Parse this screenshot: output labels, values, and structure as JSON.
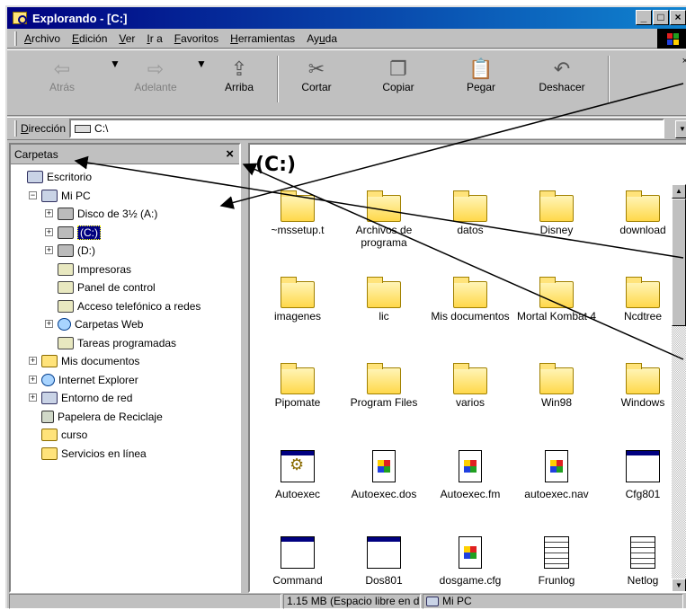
{
  "window": {
    "title": "Explorando - [C:]",
    "controls": [
      "_",
      "□",
      "×"
    ]
  },
  "menu": [
    {
      "key": "A",
      "rest": "rchivo"
    },
    {
      "key": "E",
      "rest": "dición"
    },
    {
      "key": "V",
      "rest": "er"
    },
    {
      "key": "I",
      "rest": "r a"
    },
    {
      "key": "F",
      "rest": "avoritos"
    },
    {
      "key": "H",
      "rest": "erramientas"
    },
    {
      "pre": "Ay",
      "key": "u",
      "rest": "da"
    }
  ],
  "toolbar": {
    "back": "Atrás",
    "forward": "Adelante",
    "up": "Arriba",
    "cut": "Cortar",
    "copy": "Copiar",
    "paste": "Pegar",
    "undo": "Deshacer",
    "close": "×"
  },
  "address": {
    "label_key": "D",
    "label_rest": "irección",
    "value": "C:\\"
  },
  "folders_pane": {
    "title": "Carpetas",
    "close": "×",
    "tree": [
      {
        "label": "Escritorio",
        "icon": "desktop-icon",
        "level": 0,
        "exp": ""
      },
      {
        "label": "Mi PC",
        "icon": "computer-icon",
        "level": 1,
        "exp": "−"
      },
      {
        "label": "Disco de 3½ (A:)",
        "icon": "floppy-icon",
        "level": 2,
        "exp": "+"
      },
      {
        "label": "(C:)",
        "icon": "drive-icon",
        "level": 2,
        "exp": "+",
        "selected": true
      },
      {
        "label": "(D:)",
        "icon": "cdrom-icon",
        "level": 2,
        "exp": "+"
      },
      {
        "label": "Impresoras",
        "icon": "printer-folder-icon",
        "level": 2,
        "exp": ""
      },
      {
        "label": "Panel de control",
        "icon": "control-panel-icon",
        "level": 2,
        "exp": ""
      },
      {
        "label": "Acceso telefónico a redes",
        "icon": "dialup-icon",
        "level": 2,
        "exp": ""
      },
      {
        "label": "Carpetas Web",
        "icon": "web-folder-icon",
        "level": 2,
        "exp": "+"
      },
      {
        "label": "Tareas programadas",
        "icon": "tasks-icon",
        "level": 2,
        "exp": ""
      },
      {
        "label": "Mis documentos",
        "icon": "folder-icon",
        "level": 1,
        "exp": "+"
      },
      {
        "label": "Internet Explorer",
        "icon": "ie-icon",
        "level": 1,
        "exp": "+"
      },
      {
        "label": "Entorno de red",
        "icon": "network-icon",
        "level": 1,
        "exp": "+"
      },
      {
        "label": "Papelera de Reciclaje",
        "icon": "recycle-bin-icon",
        "level": 1,
        "exp": ""
      },
      {
        "label": "curso",
        "icon": "folder-icon",
        "level": 1,
        "exp": ""
      },
      {
        "label": "Servicios en línea",
        "icon": "folder-icon",
        "level": 1,
        "exp": ""
      }
    ]
  },
  "content": {
    "heading": "(C:)",
    "items": [
      {
        "name": "~mssetup.t",
        "type": "folder"
      },
      {
        "name": "Archivos de programa",
        "type": "folder"
      },
      {
        "name": "datos",
        "type": "folder"
      },
      {
        "name": "Disney",
        "type": "folder"
      },
      {
        "name": "download",
        "type": "folder"
      },
      {
        "name": "imagenes",
        "type": "folder"
      },
      {
        "name": "lic",
        "type": "folder"
      },
      {
        "name": "Mis documentos",
        "type": "folder"
      },
      {
        "name": "Mortal Kombat 4",
        "type": "folder"
      },
      {
        "name": "Ncdtree",
        "type": "folder"
      },
      {
        "name": "Pipomate",
        "type": "folder"
      },
      {
        "name": "Program Files",
        "type": "folder"
      },
      {
        "name": "varios",
        "type": "folder"
      },
      {
        "name": "Win98",
        "type": "folder"
      },
      {
        "name": "Windows",
        "type": "folder"
      },
      {
        "name": "Autoexec",
        "type": "gear"
      },
      {
        "name": "Autoexec.dos",
        "type": "doc"
      },
      {
        "name": "Autoexec.fm",
        "type": "doc"
      },
      {
        "name": "autoexec.nav",
        "type": "doc"
      },
      {
        "name": "Cfg801",
        "type": "app"
      },
      {
        "name": "Command",
        "type": "app"
      },
      {
        "name": "Dos801",
        "type": "app"
      },
      {
        "name": "dosgame.cfg",
        "type": "doc"
      },
      {
        "name": "Frunlog",
        "type": "txt"
      },
      {
        "name": "Netlog",
        "type": "txt"
      }
    ]
  },
  "status": {
    "free_space": "1.15 MB (Espacio libre en d",
    "location": "Mi PC"
  }
}
